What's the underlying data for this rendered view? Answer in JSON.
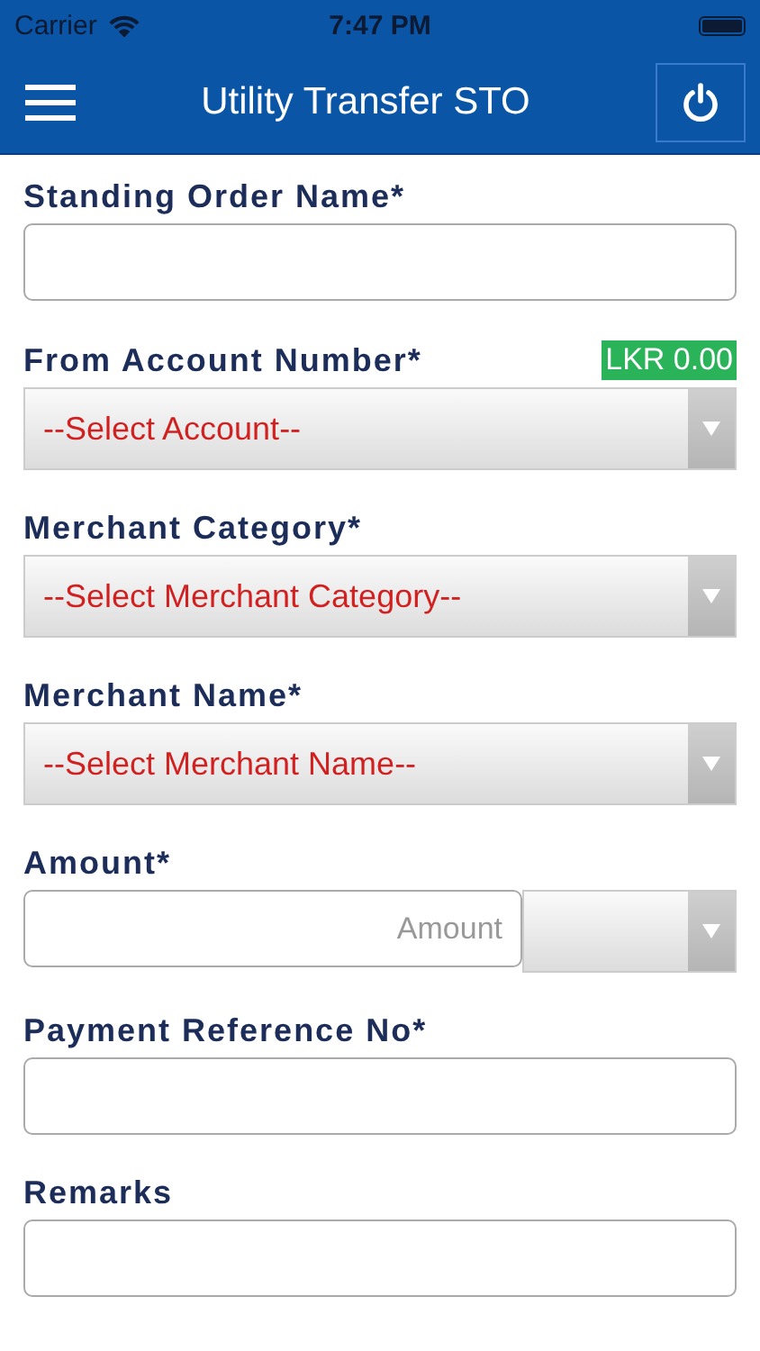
{
  "status_bar": {
    "carrier": "Carrier",
    "time": "7:47 PM"
  },
  "header": {
    "title": "Utility Transfer STO"
  },
  "fields": [
    {
      "kind": "text",
      "label": "Standing Order Name*"
    },
    {
      "kind": "select",
      "label": "From Account Number*",
      "badge": "LKR 0.00",
      "value": "--Select Account--"
    },
    {
      "kind": "select",
      "label": "Merchant Category*",
      "value": "--Select Merchant Category--"
    },
    {
      "kind": "select",
      "label": "Merchant Name*",
      "value": "--Select Merchant Name--"
    },
    {
      "kind": "amount",
      "label": "Amount*",
      "placeholder": "Amount"
    },
    {
      "kind": "text",
      "label": "Payment Reference No*"
    },
    {
      "kind": "text",
      "label": "Remarks"
    }
  ]
}
